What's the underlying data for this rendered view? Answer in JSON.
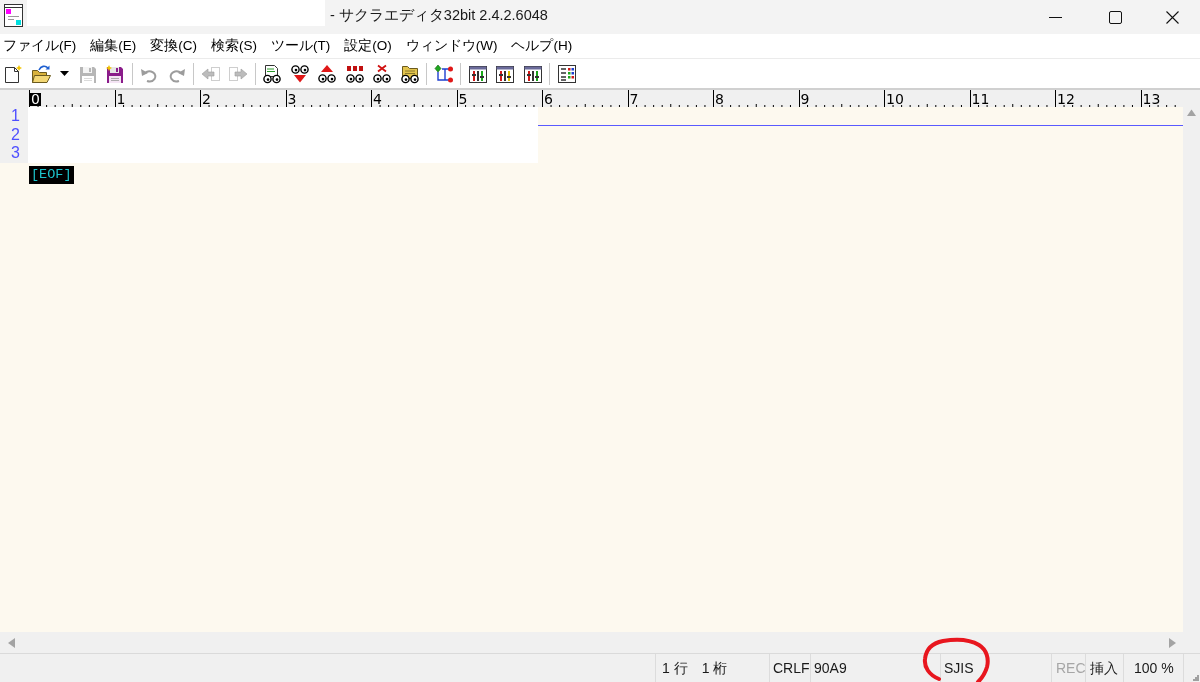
{
  "window": {
    "title": "- サクラエディタ32bit 2.4.2.6048"
  },
  "menu": [
    "ファイル(F)",
    "編集(E)",
    "変換(C)",
    "検索(S)",
    "ツール(T)",
    "設定(O)",
    "ウィンドウ(W)",
    "ヘルプ(H)"
  ],
  "toolbar": [
    {
      "kind": "button",
      "disabled": false
    },
    {
      "kind": "button",
      "disabled": false
    },
    {
      "kind": "dropdown",
      "disabled": false
    },
    {
      "kind": "button",
      "disabled": true
    },
    {
      "kind": "button",
      "disabled": false
    },
    {
      "kind": "separator"
    },
    {
      "kind": "button",
      "disabled": true
    },
    {
      "kind": "button",
      "disabled": true
    },
    {
      "kind": "separator"
    },
    {
      "kind": "button",
      "disabled": true
    },
    {
      "kind": "button",
      "disabled": true
    },
    {
      "kind": "separator"
    },
    {
      "kind": "button",
      "disabled": false
    },
    {
      "kind": "button",
      "disabled": false
    },
    {
      "kind": "button",
      "disabled": false
    },
    {
      "kind": "button",
      "disabled": false
    },
    {
      "kind": "button",
      "disabled": false
    },
    {
      "kind": "button",
      "disabled": false
    },
    {
      "kind": "separator"
    },
    {
      "kind": "button",
      "disabled": false
    },
    {
      "kind": "separator"
    },
    {
      "kind": "button",
      "disabled": false
    },
    {
      "kind": "button",
      "disabled": false
    },
    {
      "kind": "button",
      "disabled": false
    },
    {
      "kind": "separator"
    },
    {
      "kind": "button",
      "disabled": false
    }
  ],
  "ruler": {
    "labels": [
      {
        "text": "0",
        "selected": true
      },
      {
        "text": "1",
        "selected": false
      },
      {
        "text": "2",
        "selected": false
      },
      {
        "text": "3",
        "selected": false
      },
      {
        "text": "4",
        "selected": false
      },
      {
        "text": "5",
        "selected": false
      },
      {
        "text": "6",
        "selected": false
      },
      {
        "text": "7",
        "selected": false
      },
      {
        "text": "8",
        "selected": false
      },
      {
        "text": "9",
        "selected": false
      },
      {
        "text": "10",
        "selected": false
      },
      {
        "text": "11",
        "selected": false
      },
      {
        "text": "12",
        "selected": false
      },
      {
        "text": "13",
        "selected": false
      }
    ]
  },
  "editor": {
    "lines": [
      {
        "number": "1",
        "current": true
      },
      {
        "number": "2",
        "current": false
      },
      {
        "number": "3",
        "current": false
      }
    ],
    "eof_marker": "[EOF]"
  },
  "status_bar": [
    {
      "text": "1 行　1 桁",
      "disabled": false,
      "circled": false
    },
    {
      "text": "CRLF",
      "disabled": false,
      "circled": false
    },
    {
      "text": "90A9",
      "disabled": false,
      "circled": false
    },
    {
      "text": "SJIS",
      "disabled": false,
      "circled": true
    },
    {
      "text": "REC",
      "disabled": true,
      "circled": false
    },
    {
      "text": "挿入",
      "disabled": false,
      "circled": false
    },
    {
      "text": "100 %",
      "disabled": false,
      "circled": false
    }
  ]
}
